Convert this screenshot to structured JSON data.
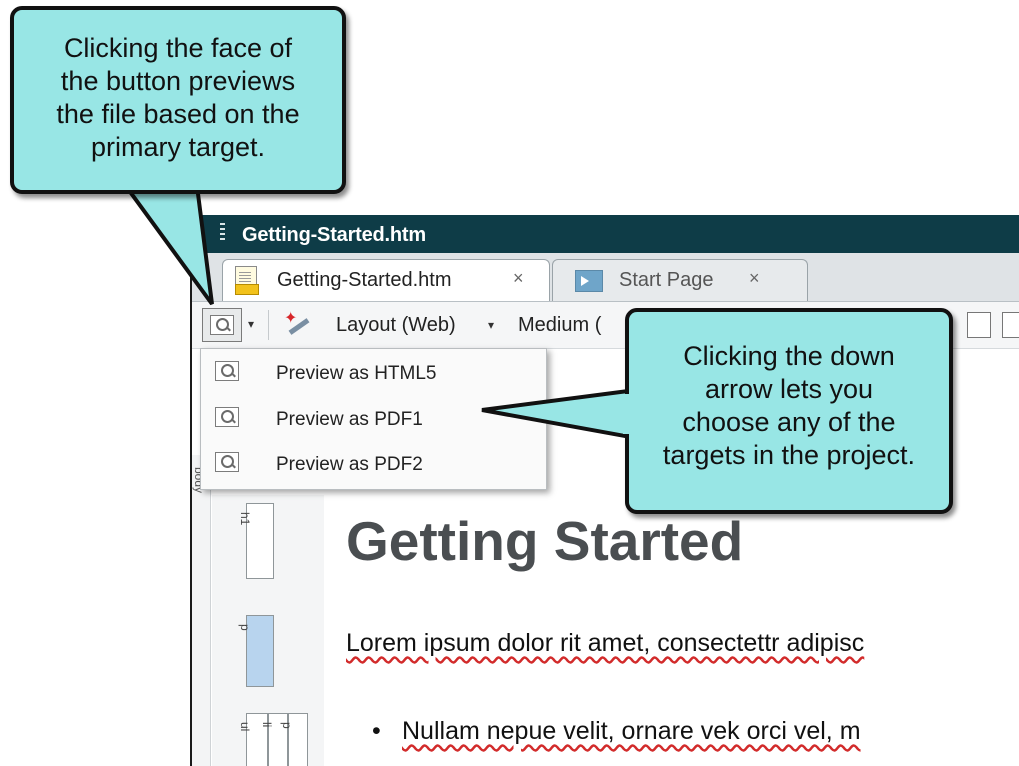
{
  "window": {
    "title": "Getting-Started.htm",
    "tabs": [
      {
        "label": "Getting-Started.htm",
        "close": "×",
        "active": true
      },
      {
        "label": "Start Page",
        "close": "×",
        "active": false
      }
    ]
  },
  "toolbar": {
    "layout_label": "Layout (Web)",
    "medium_label": "Medium (",
    "caret": "▾"
  },
  "preview_menu": {
    "items": [
      {
        "label": "Preview as HTML5",
        "icon": "preview-icon"
      },
      {
        "label": "Preview as PDF1",
        "icon": "preview-icon"
      },
      {
        "label": "Preview as PDF2",
        "icon": "preview-icon"
      }
    ]
  },
  "structure": {
    "ruler_label": "body",
    "blocks": [
      "h1",
      "p",
      "ul",
      "li",
      "p"
    ]
  },
  "document": {
    "heading": "Getting Started",
    "paragraph": "Lorem ipsum dolor rit amet, consectettr adipisc",
    "bullet": "Nullam nepue velit, ornare vek orci vel, m"
  },
  "callouts": {
    "button_face": "Clicking the face of\nthe button previews\nthe file based on the\nprimary target.",
    "down_arrow": "Clicking the down\narrow lets you\nchoose any of the\ntargets in the project."
  },
  "colors": {
    "callout_fill": "#98e6e5",
    "titlebar": "#0e3c47",
    "spellcheck": "#d22b2b"
  }
}
